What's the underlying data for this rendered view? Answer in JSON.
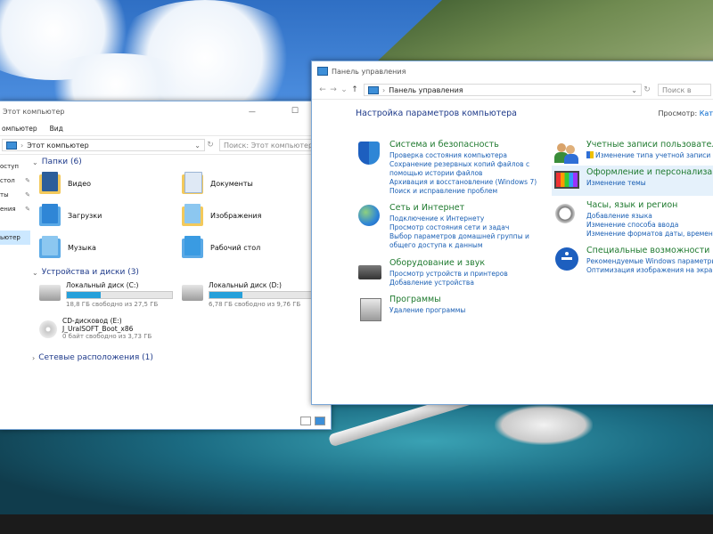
{
  "colors": {
    "link": "#1a5fb4",
    "category": "#1f7a2f",
    "heading": "#1e3a8a",
    "accent": "#26a0da"
  },
  "explorer": {
    "title": "Этот компьютер",
    "address": "Этот компьютер",
    "search_placeholder": "Поиск: Этот компьютер",
    "menu": [
      "омпьютер",
      "Вид"
    ],
    "sidebar": [
      "доступ",
      "Рабочий стол",
      "Загрузки",
      "Документы",
      "Изображения",
      "Этот компьютер"
    ],
    "sidebar_visible": [
      "оступ",
      "стол",
      "ты",
      "ения",
      "",
      "ьютер"
    ],
    "folders_header": "Папки (6)",
    "folders": [
      {
        "name": "Видео",
        "icon": "video-folder-icon"
      },
      {
        "name": "Документы",
        "icon": "documents-folder-icon"
      },
      {
        "name": "Загрузки",
        "icon": "downloads-folder-icon"
      },
      {
        "name": "Изображения",
        "icon": "pictures-folder-icon"
      },
      {
        "name": "Музыка",
        "icon": "music-folder-icon"
      },
      {
        "name": "Рабочий стол",
        "icon": "desktop-folder-icon"
      }
    ],
    "devices_header": "Устройства и диски (3)",
    "drives": [
      {
        "name": "Локальный диск (C:)",
        "free": "18,8 ГБ свободно из 27,5 ГБ",
        "used_fraction": 0.32
      },
      {
        "name": "Локальный диск (D:)",
        "free": "6,78 ГБ свободно из 9,76 ГБ",
        "used_fraction": 0.31
      },
      {
        "name": "CD-дисковод (E:) J_UralSOFT_Boot_x86",
        "free": "0 байт свободно из 3,73 ГБ",
        "used_fraction": 1.0
      }
    ],
    "network_header": "Сетевые расположения (1)"
  },
  "cp": {
    "title": "Панель управления",
    "address": "Панель управления",
    "search_placeholder": "Поиск в",
    "heading": "Настройка параметров компьютера",
    "view_label": "Просмотр:",
    "view_value": "Кат",
    "categories": [
      {
        "title": "Система и безопасность",
        "icon": "system-security-icon",
        "links": [
          "Проверка состояния компьютера",
          "Сохранение резервных копий файлов с помощью истории файлов",
          "Архивация и восстановление (Windows 7)",
          "Поиск и исправление проблем"
        ]
      },
      {
        "title": "Сеть и Интернет",
        "icon": "network-internet-icon",
        "links": [
          "Подключение к Интернету",
          "Просмотр состояния сети и задач",
          "Выбор параметров домашней группы и общего доступа к данным"
        ]
      },
      {
        "title": "Оборудование и звук",
        "icon": "hardware-sound-icon",
        "links": [
          "Просмотр устройств и принтеров",
          "Добавление устройства"
        ]
      },
      {
        "title": "Программы",
        "icon": "programs-icon",
        "links": [
          "Удаление программы"
        ]
      },
      {
        "title": "Учетные записи пользователей",
        "icon": "user-accounts-icon",
        "links": [
          "Изменение типа учетной записи"
        ]
      },
      {
        "title": "Оформление и персонализация",
        "icon": "appearance-icon",
        "links": [
          "Изменение темы"
        ]
      },
      {
        "title": "Часы, язык и регион",
        "icon": "clock-region-icon",
        "links": [
          "Добавление языка",
          "Изменение способа ввода",
          "Изменение форматов даты, времени и чисел"
        ]
      },
      {
        "title": "Специальные возможности",
        "icon": "ease-of-access-icon",
        "links": [
          "Рекомендуемые Windows параметры",
          "Оптимизация изображения на экране"
        ]
      }
    ]
  }
}
